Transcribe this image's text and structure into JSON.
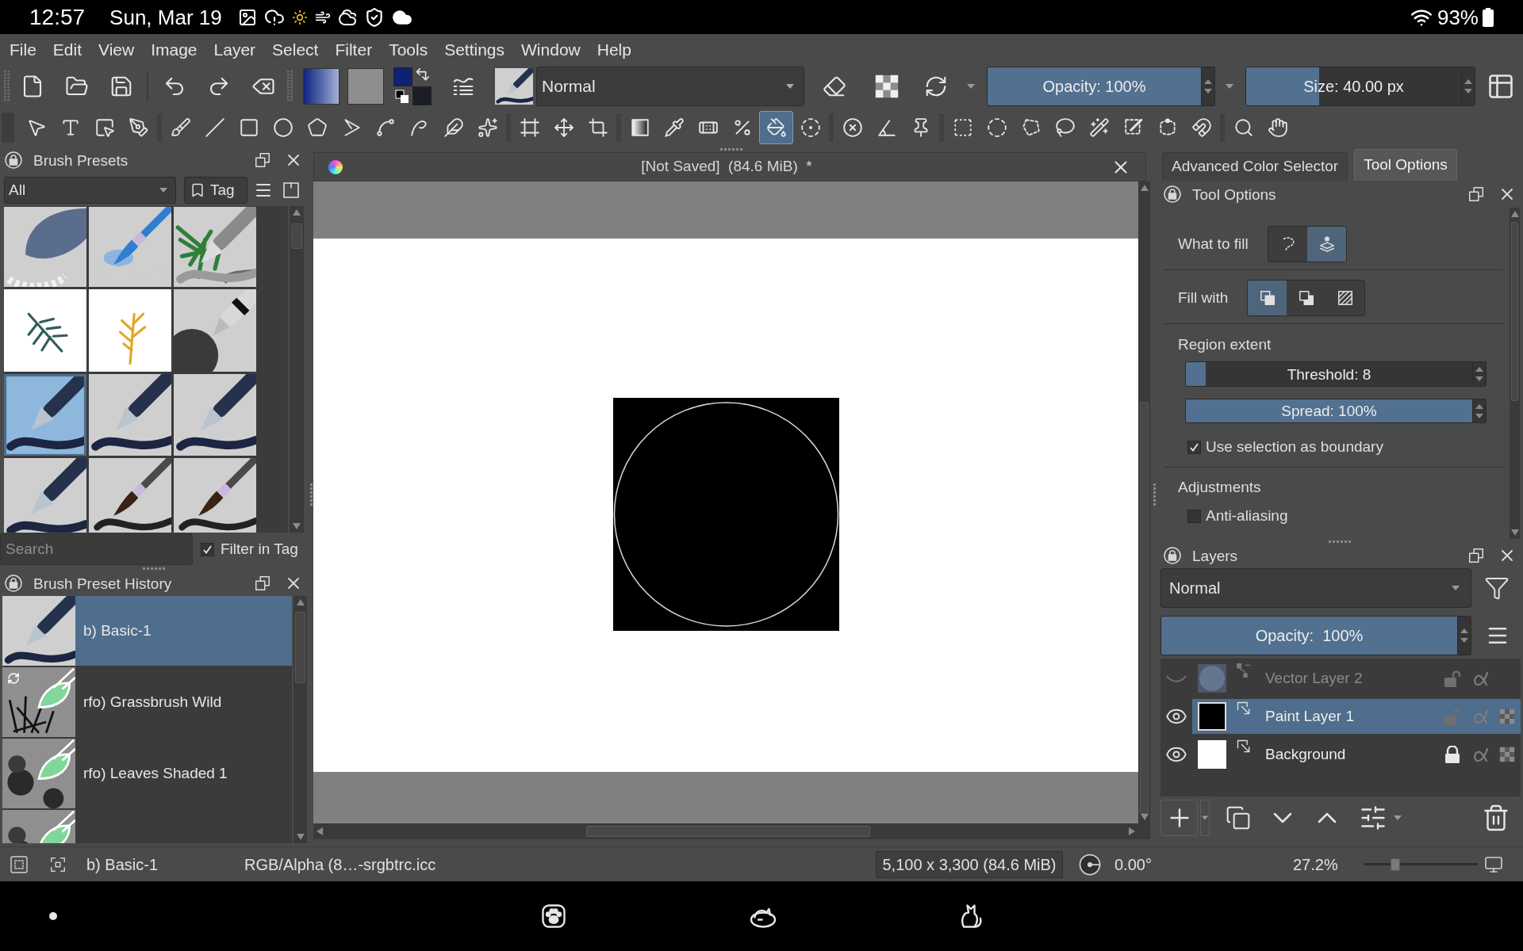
{
  "device_status": {
    "time": "12:57",
    "date": "Sun, Mar 19",
    "battery": "93%"
  },
  "menu": [
    "File",
    "Edit",
    "View",
    "Image",
    "Layer",
    "Select",
    "Filter",
    "Tools",
    "Settings",
    "Window",
    "Help"
  ],
  "toolbar": {
    "colors": [
      {
        "kind": "foreground",
        "color": "#0d2270"
      },
      {
        "kind": "background",
        "color": "#1b1e25"
      }
    ],
    "blend_mode": "Normal",
    "opacity": {
      "text": "Opacity: 100%",
      "level": 1
    },
    "size": {
      "text": "Size: 40.00 px",
      "level": 0.34
    }
  },
  "tool_groups": [
    [
      {
        "kind": "arrow",
        "selected": false
      },
      {
        "kind": "text",
        "selected": false
      },
      {
        "kind": "shapes",
        "selected": false
      },
      {
        "kind": "calligraphy",
        "selected": false
      }
    ],
    [
      {
        "kind": "brush",
        "selected": false
      },
      {
        "kind": "line",
        "selected": false
      },
      {
        "kind": "rect",
        "selected": false
      },
      {
        "kind": "ellipse",
        "selected": false
      },
      {
        "kind": "polygon",
        "selected": false
      },
      {
        "kind": "polyline",
        "selected": false
      },
      {
        "kind": "bezier",
        "selected": false
      },
      {
        "kind": "freehand",
        "selected": false
      },
      {
        "kind": "dynamic",
        "selected": false
      },
      {
        "kind": "multibrush",
        "selected": false
      }
    ],
    [
      {
        "kind": "transform",
        "selected": false
      },
      {
        "kind": "move",
        "selected": false
      },
      {
        "kind": "crop",
        "selected": false
      }
    ],
    [
      {
        "kind": "gradient",
        "selected": false
      },
      {
        "kind": "picker",
        "selected": false
      },
      {
        "kind": "patch",
        "selected": false
      },
      {
        "kind": "colorize",
        "selected": false
      },
      {
        "kind": "fill",
        "selected": true
      },
      {
        "kind": "enclose",
        "selected": false
      }
    ],
    [
      {
        "kind": "assistant",
        "selected": false
      },
      {
        "kind": "measure",
        "selected": false
      },
      {
        "kind": "reference",
        "selected": false
      }
    ],
    [
      {
        "kind": "rectselect",
        "selected": false
      },
      {
        "kind": "ellipseselect",
        "selected": false
      },
      {
        "kind": "polygonselect",
        "selected": false
      },
      {
        "kind": "freehandselect",
        "selected": false
      },
      {
        "kind": "wand",
        "selected": false
      },
      {
        "kind": "colorselect",
        "selected": false
      },
      {
        "kind": "bezierselect",
        "selected": false
      },
      {
        "kind": "magnetic",
        "selected": false
      }
    ],
    [
      {
        "kind": "zoom",
        "selected": false
      },
      {
        "kind": "pan",
        "selected": false
      }
    ]
  ],
  "brush_presets": {
    "title": "Brush Presets",
    "filter": "All",
    "tag_button": "Tag",
    "presets": [
      {
        "kind": "blender",
        "selected": false
      },
      {
        "kind": "brush",
        "selected": false
      },
      {
        "kind": "foliage",
        "selected": false
      },
      {
        "kind": "fern",
        "selected": false
      },
      {
        "kind": "sprig",
        "selected": false
      },
      {
        "kind": "airbrush",
        "selected": false
      },
      {
        "kind": "pen",
        "selected": true
      },
      {
        "kind": "pen",
        "selected": false
      },
      {
        "kind": "pen",
        "selected": false
      },
      {
        "kind": "pen",
        "selected": false
      },
      {
        "kind": "paintbrush",
        "selected": false
      },
      {
        "kind": "paintbrush",
        "selected": false
      }
    ],
    "search": {
      "placeholder": "Search"
    },
    "filter_in_tag": {
      "label": "Filter in Tag",
      "checked": true
    }
  },
  "brush_preset_history": {
    "title": "Brush Preset History",
    "items": [
      {
        "label": "b) Basic-1",
        "kind": "pen",
        "selected": true,
        "modified": false
      },
      {
        "label": "rfo) Grassbrush Wild",
        "kind": "grass",
        "selected": false,
        "modified": true
      },
      {
        "label": "rfo) Leaves Shaded 1",
        "kind": "leaves",
        "selected": false,
        "modified": false
      },
      {
        "kind": "leaves",
        "selected": false,
        "modified": false
      }
    ]
  },
  "document": {
    "title": "[Not Saved]  (84.6 MiB)  *"
  },
  "dock_tabs": [
    {
      "label": "Advanced Color Selector",
      "selected": false
    },
    {
      "label": "Tool Options",
      "selected": true
    }
  ],
  "tool_options": {
    "title": "Tool Options",
    "what_to_fill": {
      "label": "What to fill",
      "options": [
        {
          "kind": "selection",
          "selected": false
        },
        {
          "kind": "similar",
          "selected": true
        }
      ]
    },
    "fill_with": {
      "label": "Fill with",
      "options": [
        {
          "kind": "foreground",
          "selected": true
        },
        {
          "kind": "background",
          "selected": false
        },
        {
          "kind": "pattern",
          "selected": false
        }
      ]
    },
    "region_extent": {
      "label": "Region extent",
      "threshold": {
        "text": "Threshold: 8",
        "level": 0.07
      },
      "spread": {
        "text": "Spread: 100%",
        "level": 1
      },
      "use_selection_as_boundary": {
        "label": "Use selection as boundary",
        "checked": true
      }
    },
    "adjustments": {
      "label": "Adjustments",
      "anti_aliasing": {
        "label": "Anti-aliasing",
        "checked": false
      }
    }
  },
  "layers": {
    "title": "Layers",
    "blend_mode": "Normal",
    "opacity": {
      "text": "Opacity:  100%",
      "level": 1
    },
    "items": [
      {
        "name": "Vector Layer 2",
        "kind": "vector",
        "visible": false,
        "locked": false,
        "selected": false
      },
      {
        "name": "Paint Layer 1",
        "kind": "paint",
        "visible": true,
        "locked": false,
        "selected": true
      },
      {
        "name": "Background",
        "kind": "background",
        "visible": true,
        "locked": true,
        "selected": false
      }
    ]
  },
  "status_bar": {
    "brush": "b) Basic-1",
    "color_profile": "RGB/Alpha (8…-srgbtrc.icc",
    "image_size": "5,100 x 3,300 (84.6 MiB)",
    "rotation": "0.00°",
    "zoom": "27.2%",
    "zoom_slider": {
      "level": 0.28
    }
  }
}
